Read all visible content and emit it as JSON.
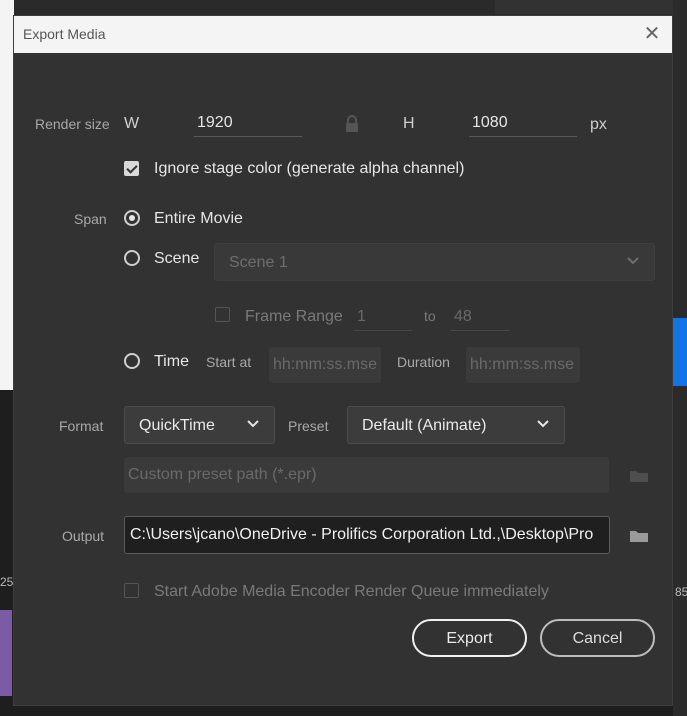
{
  "dialog": {
    "title": "Export Media"
  },
  "render_size": {
    "label": "Render size",
    "w_label": "W",
    "w_value": "1920",
    "h_label": "H",
    "h_value": "1080",
    "unit": "px"
  },
  "ignore_stage": {
    "label": "Ignore stage color (generate alpha channel)",
    "checked": true
  },
  "span": {
    "label": "Span",
    "entire_movie": "Entire Movie",
    "scene": "Scene",
    "scene_value": "Scene 1",
    "frame_range_label": "Frame Range",
    "frame_from": "1",
    "to_label": "to",
    "frame_to": "48",
    "time": "Time",
    "start_at_label": "Start at",
    "start_placeholder": "hh:mm:ss.mse",
    "duration_label": "Duration",
    "duration_placeholder": "hh:mm:ss.mse"
  },
  "format": {
    "label": "Format",
    "value": "QuickTime",
    "preset_label": "Preset",
    "preset_value": "Default (Animate)",
    "custom_path_placeholder": "Custom preset path (*.epr)"
  },
  "output": {
    "label": "Output",
    "path": "C:\\Users\\jcano\\OneDrive - Prolifics Corporation Ltd.,\\Desktop\\Pro"
  },
  "queue": {
    "label": "Start Adobe Media Encoder Render Queue immediately",
    "checked": false
  },
  "buttons": {
    "export": "Export",
    "cancel": "Cancel"
  },
  "background": {
    "ruler_left": "25",
    "ruler_right": "85"
  },
  "colors": {
    "dialog_bg": "#323232",
    "titlebar_bg": "#f4f4f4",
    "accent_blue": "#1473e6"
  }
}
